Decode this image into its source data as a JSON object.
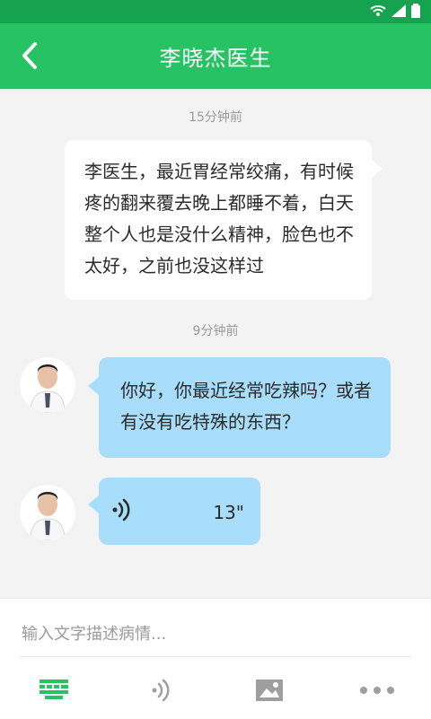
{
  "header": {
    "title": "李晓杰医生"
  },
  "messages": [
    {
      "time": "15分钟前",
      "sender": "me",
      "text": "李医生，最近胃经常绞痛，有时候疼的翻来覆去晚上都睡不着，白天整个人也是没什么精神，脸色也不太好，之前也没这样过"
    },
    {
      "time": "9分钟前",
      "sender": "doctor",
      "text": "你好，你最近经常吃辣吗？或者有没有吃特殊的东西？"
    },
    {
      "sender": "doctor",
      "type": "voice",
      "duration": "13\""
    }
  ],
  "input": {
    "placeholder": "输入文字描述病情..."
  },
  "toolbar": {
    "items": [
      "keyboard-icon",
      "voice-icon",
      "image-icon",
      "more-icon"
    ]
  },
  "colors": {
    "header_green": "#27c263",
    "status_green": "#16a34f",
    "doctor_bubble": "#a8ddfb",
    "user_bubble": "#ffffff",
    "keyboard_active": "#27c263",
    "inactive_icon": "#9e9e9e"
  }
}
